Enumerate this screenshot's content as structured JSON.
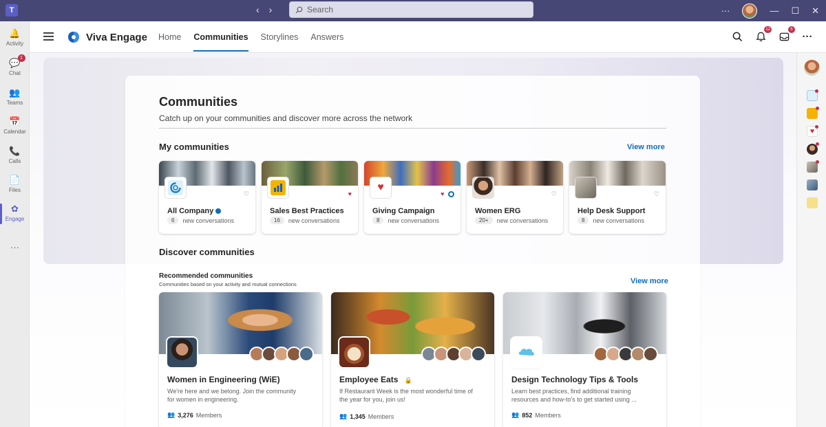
{
  "titlebar": {
    "app_letter": "T",
    "back": "‹",
    "forward": "›",
    "search_placeholder": "Search",
    "more": "···",
    "minimize": "—",
    "maximize": "☐",
    "close": "✕"
  },
  "leftrail": {
    "items": [
      {
        "label": "Activity",
        "icon": "🔔"
      },
      {
        "label": "Chat",
        "icon": "💬",
        "badge": "1"
      },
      {
        "label": "Teams",
        "icon": "👥"
      },
      {
        "label": "Calendar",
        "icon": "📅"
      },
      {
        "label": "Calls",
        "icon": "📞"
      },
      {
        "label": "Files",
        "icon": "📄"
      },
      {
        "label": "Engage",
        "icon": "✿"
      }
    ],
    "more": "···"
  },
  "header": {
    "app_name": "Viva Engage",
    "nav": [
      "Home",
      "Communities",
      "Storylines",
      "Answers"
    ],
    "notification_count": "12",
    "inbox_count": "5",
    "more": "···"
  },
  "page": {
    "title": "Communities",
    "subtitle": "Catch up on your communities and discover more across the network"
  },
  "my_communities": {
    "title": "My communities",
    "view_more": "View more",
    "cards": [
      {
        "name": "All Company",
        "verified": true,
        "count": "6",
        "count_label": "new conversations",
        "favorited": false
      },
      {
        "name": "Sales Best Practices",
        "count": "16",
        "count_label": "new conversations",
        "favorited": true
      },
      {
        "name": "Giving Campaign",
        "count": "8",
        "count_label": "new conversations",
        "favorited": true
      },
      {
        "name": "Women ERG",
        "count": "20+",
        "count_label": "new conversations",
        "favorited": false
      },
      {
        "name": "Help Desk Support",
        "count": "8",
        "count_label": "new conversations",
        "favorited": false
      }
    ]
  },
  "discover": {
    "title": "Discover communities",
    "recommended_title": "Recommended communities",
    "recommended_sub": "Communities based on your activity and mutual connections",
    "view_more": "View more",
    "cards": [
      {
        "name": "Women in Engineering (WiE)",
        "description": "We're here and we belong. Join the community for women in engineering.",
        "members": "3,276",
        "members_label": "Members"
      },
      {
        "name": "Employee Eats",
        "description": "If Restaurant Week is the most wonderful time of the year for you, join us!",
        "members": "1,345",
        "members_label": "Members",
        "private": true
      },
      {
        "name": "Design Technology Tips & Tools",
        "description": "Learn best practices, find additional training resources and how-to's to get started using ...",
        "members": "852",
        "members_label": "Members"
      }
    ]
  },
  "colors": {
    "titlebar": "#464775",
    "accent": "#5b5fc7",
    "link": "#0f6cbd",
    "badge": "#c4314b"
  }
}
